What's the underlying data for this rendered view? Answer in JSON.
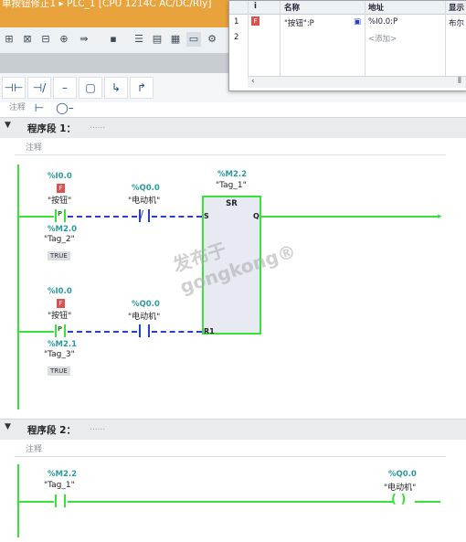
{
  "titlebar": {
    "text": "单按钮修正1 ▸ PLC_1 [CPU 1214C AC/DC/Rly]"
  },
  "tag_table": {
    "headers": {
      "icon": "i",
      "name": "名称",
      "address": "地址",
      "display": "显示"
    },
    "rows": [
      {
        "num": "1",
        "name": "\"按钮\":P",
        "address": "%I0.0:P",
        "display": "布尔"
      },
      {
        "num": "2",
        "name": "",
        "address": "<添加>",
        "display": ""
      }
    ]
  },
  "top_comment": "注释",
  "network1": {
    "title": "程序段 1：",
    "dots": "......",
    "comment": "注释",
    "row1": {
      "p_contact": {
        "addr": "%I0.0",
        "tag": "\"按钮\"",
        "edge": "P",
        "edge_addr": "%M2.0",
        "edge_tag": "\"Tag_2\"",
        "edge_value": "TRUE"
      },
      "nc_contact": {
        "addr": "%Q0.0",
        "tag": "\"电动机\""
      }
    },
    "sr": {
      "addr": "%M2.2",
      "tag": "\"Tag_1\"",
      "label": "SR",
      "pin_s": "S",
      "pin_q": "Q",
      "pin_r1": "R1"
    },
    "row2": {
      "p_contact": {
        "addr": "%I0.0",
        "tag": "\"按钮\"",
        "edge": "P",
        "edge_addr": "%M2.1",
        "edge_tag": "\"Tag_3\"",
        "edge_value": "TRUE"
      },
      "no_contact": {
        "addr": "%Q0.0",
        "tag": "\"电动机\""
      }
    }
  },
  "network2": {
    "title": "程序段 2：",
    "dots": "......",
    "comment": "注释",
    "contact": {
      "addr": "%M2.2",
      "tag": "\"Tag_1\""
    },
    "coil": {
      "addr": "%Q0.0",
      "tag": "\"电动机\""
    }
  },
  "watermark": "发布于 gongkong®",
  "colors": {
    "energized": "#39e239",
    "address": "#2a9aa0",
    "titlebar": "#e8a33c"
  }
}
